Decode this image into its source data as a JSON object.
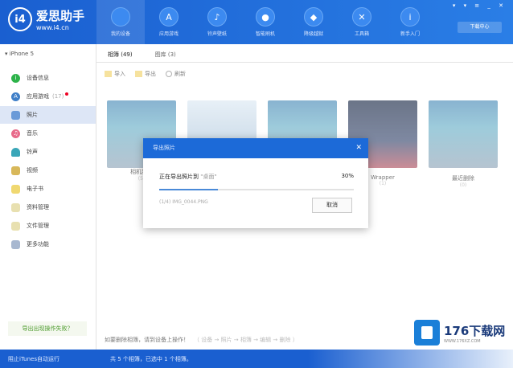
{
  "app": {
    "logo_badge": "i4",
    "name": "爱思助手",
    "url": "www.i4.cn",
    "window_controls": "▾ ▾ ≡ _ ✕",
    "download_button": "下载中心"
  },
  "nav": [
    {
      "label": "我的设备",
      "icon": "apple-icon",
      "glyph": ""
    },
    {
      "label": "应用游戏",
      "icon": "app-store-icon",
      "glyph": "A"
    },
    {
      "label": "铃声壁纸",
      "icon": "bell-icon",
      "glyph": "♪"
    },
    {
      "label": "智能刷机",
      "icon": "flash-icon",
      "glyph": "●"
    },
    {
      "label": "降级越狱",
      "icon": "jailbreak-icon",
      "glyph": "◆"
    },
    {
      "label": "工具箱",
      "icon": "tools-icon",
      "glyph": "✕"
    },
    {
      "label": "新手入门",
      "icon": "info-icon",
      "glyph": "i"
    }
  ],
  "sidebar": {
    "device": "▾ iPhone 5",
    "items": [
      {
        "label": "设备信息",
        "color": "#2db34a",
        "glyph": "i"
      },
      {
        "label": "应用游戏",
        "badge": "(17)",
        "color": "#3f7fc8",
        "glyph": "A"
      },
      {
        "label": "照片",
        "color": "#6a9ad8",
        "glyph": ""
      },
      {
        "label": "音乐",
        "color": "#e86a8a",
        "glyph": "♫"
      },
      {
        "label": "铃声",
        "color": "#3aa6b8",
        "glyph": ""
      },
      {
        "label": "视频",
        "color": "#d8b85a",
        "glyph": ""
      },
      {
        "label": "电子书",
        "color": "#f0d870",
        "glyph": ""
      },
      {
        "label": "资料管理",
        "color": "#e8e0b0",
        "glyph": ""
      },
      {
        "label": "文件管理",
        "color": "#e8e0b0",
        "glyph": ""
      },
      {
        "label": "更多功能",
        "color": "#a8b8d0",
        "glyph": ""
      }
    ],
    "help": "导出出现操作失败？"
  },
  "tabs": [
    {
      "label": "相簿 (49)"
    },
    {
      "label": "图库 (3)"
    }
  ],
  "toolbar": {
    "import": "导入",
    "export": "导出",
    "refresh": "刷新"
  },
  "albums": [
    {
      "name": "相机胶卷",
      "count": "(5)"
    },
    {
      "name": "",
      "count": ""
    },
    {
      "name": "",
      "count": ""
    },
    {
      "name": "Wrapper",
      "count": "(1)"
    },
    {
      "name": "最近删除",
      "count": "(0)"
    }
  ],
  "dialog": {
    "title": "导出照片",
    "message": "正在导出照片到",
    "destination": "\"桌面\"",
    "percent_label": "30%",
    "progress": 0.3,
    "file": "(1/4) IMG_0044.PNG",
    "cancel": "取消",
    "close": "✕"
  },
  "hint": {
    "text": "如要删除相簿，请到设备上操作！",
    "path": "（ 设备 → 照片 → 相簿 → 编辑 → 删除 ）"
  },
  "status": {
    "itunes": "阻止iTunes自动运行",
    "selection": "共 5 个相簿，已选中 1 个相簿。"
  },
  "watermark": {
    "name": "176下载网",
    "url": "WWW.176XZ.COM"
  }
}
